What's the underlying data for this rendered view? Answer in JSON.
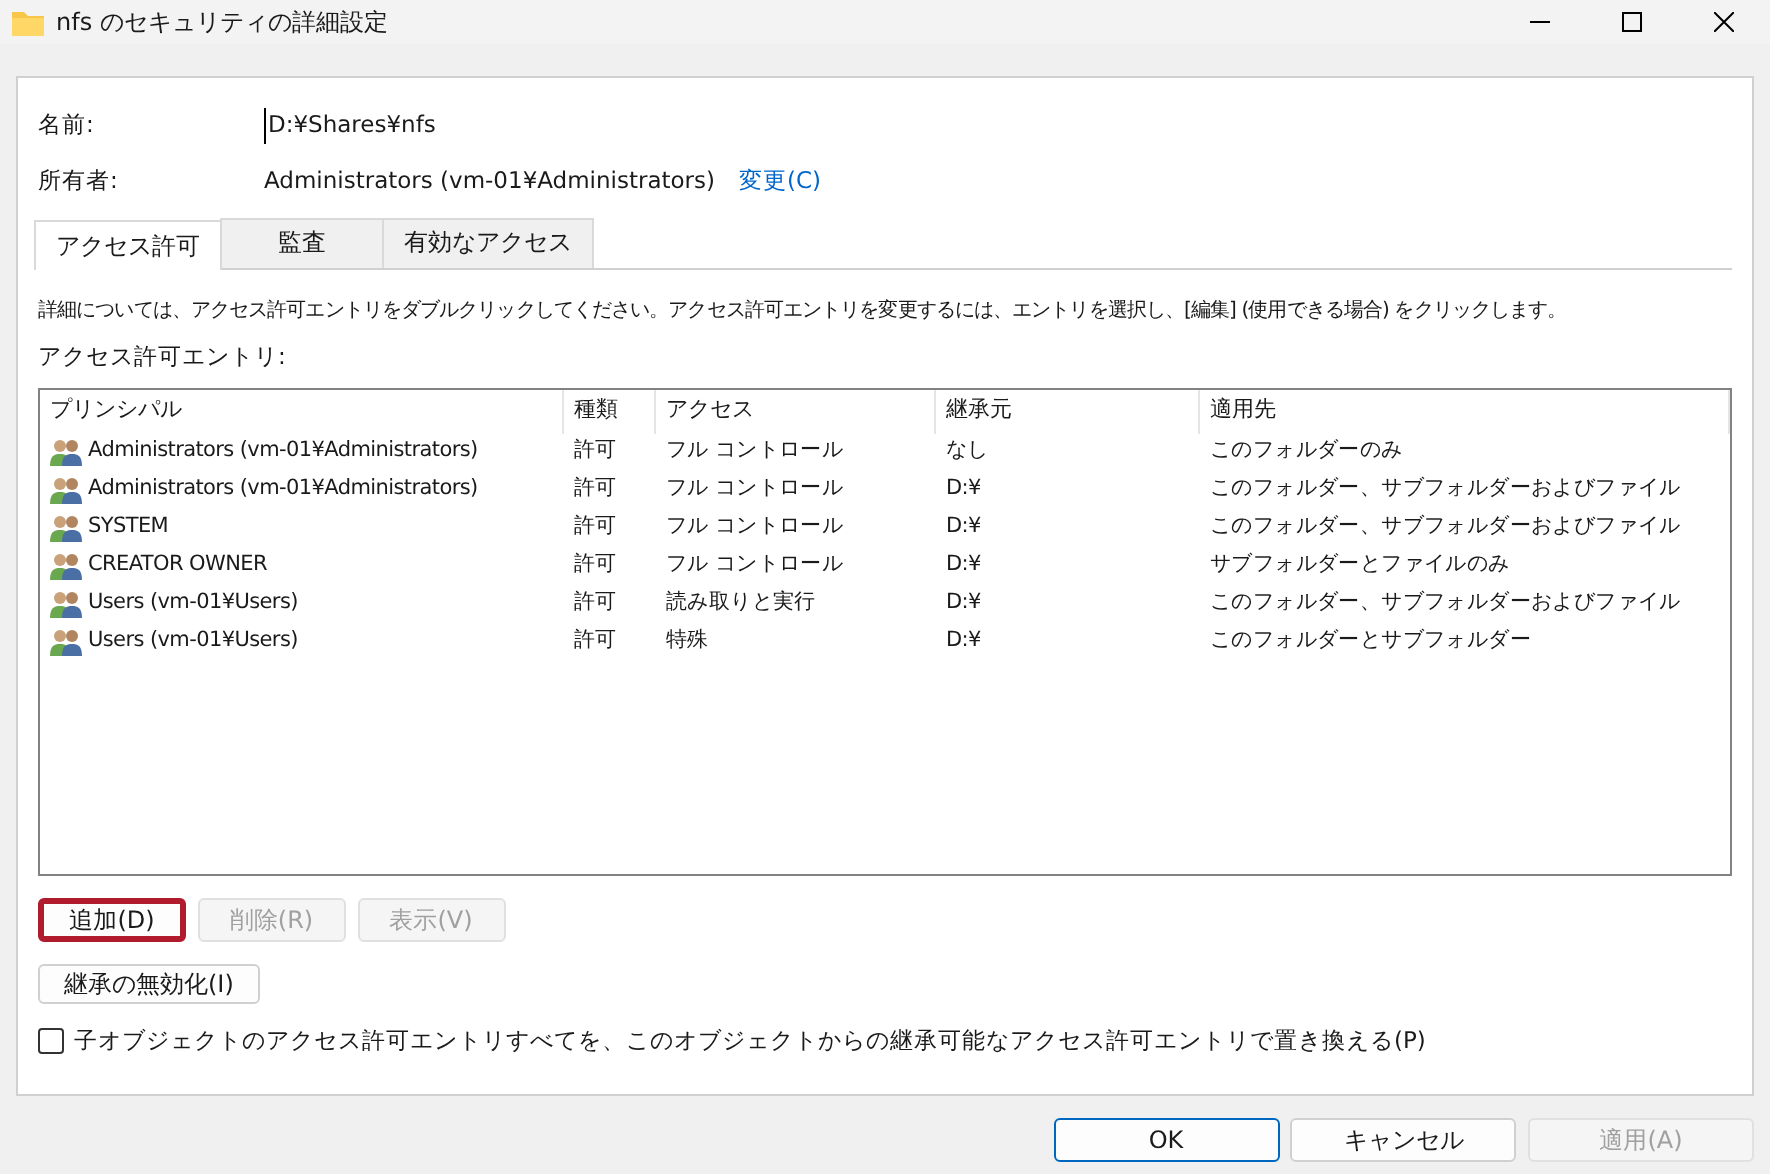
{
  "window": {
    "title": "nfs のセキュリティの詳細設定"
  },
  "name_field": {
    "label": "名前:",
    "value": "D:¥Shares¥nfs"
  },
  "owner": {
    "label": "所有者:",
    "value": "Administrators (vm-01¥Administrators)",
    "change_link": "変更(C)"
  },
  "tabs": [
    {
      "label": "アクセス許可",
      "selected": true
    },
    {
      "label": "監査",
      "selected": false
    },
    {
      "label": "有効なアクセス",
      "selected": false
    }
  ],
  "instructions": "詳細については、アクセス許可エントリをダブルクリックしてください。アクセス許可エントリを変更するには、エントリを選択し、[編集] (使用できる場合) をクリックします。",
  "entries_label": "アクセス許可エントリ:",
  "table": {
    "columns": [
      "プリンシパル",
      "種類",
      "アクセス",
      "継承元",
      "適用先"
    ],
    "rows": [
      [
        "Administrators (vm-01¥Administrators)",
        "許可",
        "フル コントロール",
        "なし",
        "このフォルダーのみ"
      ],
      [
        "Administrators (vm-01¥Administrators)",
        "許可",
        "フル コントロール",
        "D:¥",
        "このフォルダー、サブフォルダーおよびファイル"
      ],
      [
        "SYSTEM",
        "許可",
        "フル コントロール",
        "D:¥",
        "このフォルダー、サブフォルダーおよびファイル"
      ],
      [
        "CREATOR OWNER",
        "許可",
        "フル コントロール",
        "D:¥",
        "サブフォルダーとファイルのみ"
      ],
      [
        "Users (vm-01¥Users)",
        "許可",
        "読み取りと実行",
        "D:¥",
        "このフォルダー、サブフォルダーおよびファイル"
      ],
      [
        "Users (vm-01¥Users)",
        "許可",
        "特殊",
        "D:¥",
        "このフォルダーとサブフォルダー"
      ]
    ]
  },
  "entry_buttons": [
    {
      "label": "追加(D)",
      "disabled": false,
      "highlighted": true
    },
    {
      "label": "削除(R)",
      "disabled": true,
      "highlighted": false
    },
    {
      "label": "表示(V)",
      "disabled": true,
      "highlighted": false
    }
  ],
  "inherit_button": {
    "label": "継承の無効化(I)"
  },
  "replace_checkbox": {
    "label": "子オブジェクトのアクセス許可エントリすべてを、このオブジェクトからの継承可能なアクセス許可エントリで置き換える(P)",
    "checked": false
  },
  "dialog_buttons": [
    {
      "label": "OK",
      "disabled": false,
      "default": true
    },
    {
      "label": "キャンセル",
      "disabled": false,
      "default": false
    },
    {
      "label": "適用(A)",
      "disabled": true,
      "default": false
    }
  ]
}
